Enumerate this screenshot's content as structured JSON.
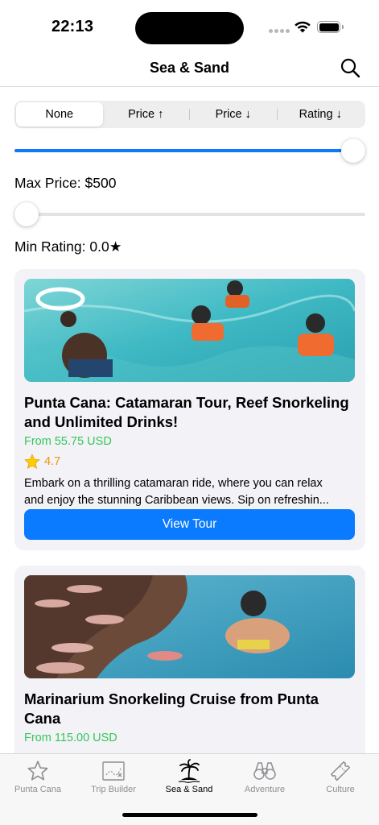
{
  "status": {
    "time": "22:13"
  },
  "nav": {
    "title": "Sea & Sand",
    "search_icon": "magnifyingglass-icon"
  },
  "sort": {
    "options": [
      "None",
      "Price ↑",
      "Price ↓",
      "Rating ↓"
    ],
    "selected": "None"
  },
  "filters": {
    "max_price_label": "Max Price: $500",
    "max_price_value": 500,
    "max_price_fraction": 1.0,
    "min_rating_label": "Min Rating: 0.0★",
    "min_rating_value": 0.0,
    "min_rating_fraction": 0.0
  },
  "tours": [
    {
      "title": "Punta Cana: Catamaran Tour, Reef Snorkeling and Unlimited Drinks!",
      "price": "From 55.75 USD",
      "rating": "4.7",
      "rating_icon": "star-icon",
      "description_lines": [
        "Embark on a thrilling catamaran ride, where you can relax",
        "and enjoy the stunning Caribbean views. Sip on refreshin..."
      ],
      "button": "View Tour"
    },
    {
      "title": "Marinarium Snorkeling Cruise from Punta Cana",
      "price": "From 115.00 USD"
    }
  ],
  "tabs": [
    {
      "label": "Punta Cana",
      "icon": "star-icon",
      "active": false
    },
    {
      "label": "Trip Builder",
      "icon": "map-icon",
      "active": false
    },
    {
      "label": "Sea & Sand",
      "icon": "palm-island-icon",
      "active": true
    },
    {
      "label": "Adventure",
      "icon": "binoculars-icon",
      "active": false
    },
    {
      "label": "Culture",
      "icon": "ticket-icon",
      "active": false
    }
  ],
  "colors": {
    "accent": "#0a7aff",
    "price": "#34c759",
    "rating": "#e99a00",
    "card_bg": "#f2f2f7"
  }
}
